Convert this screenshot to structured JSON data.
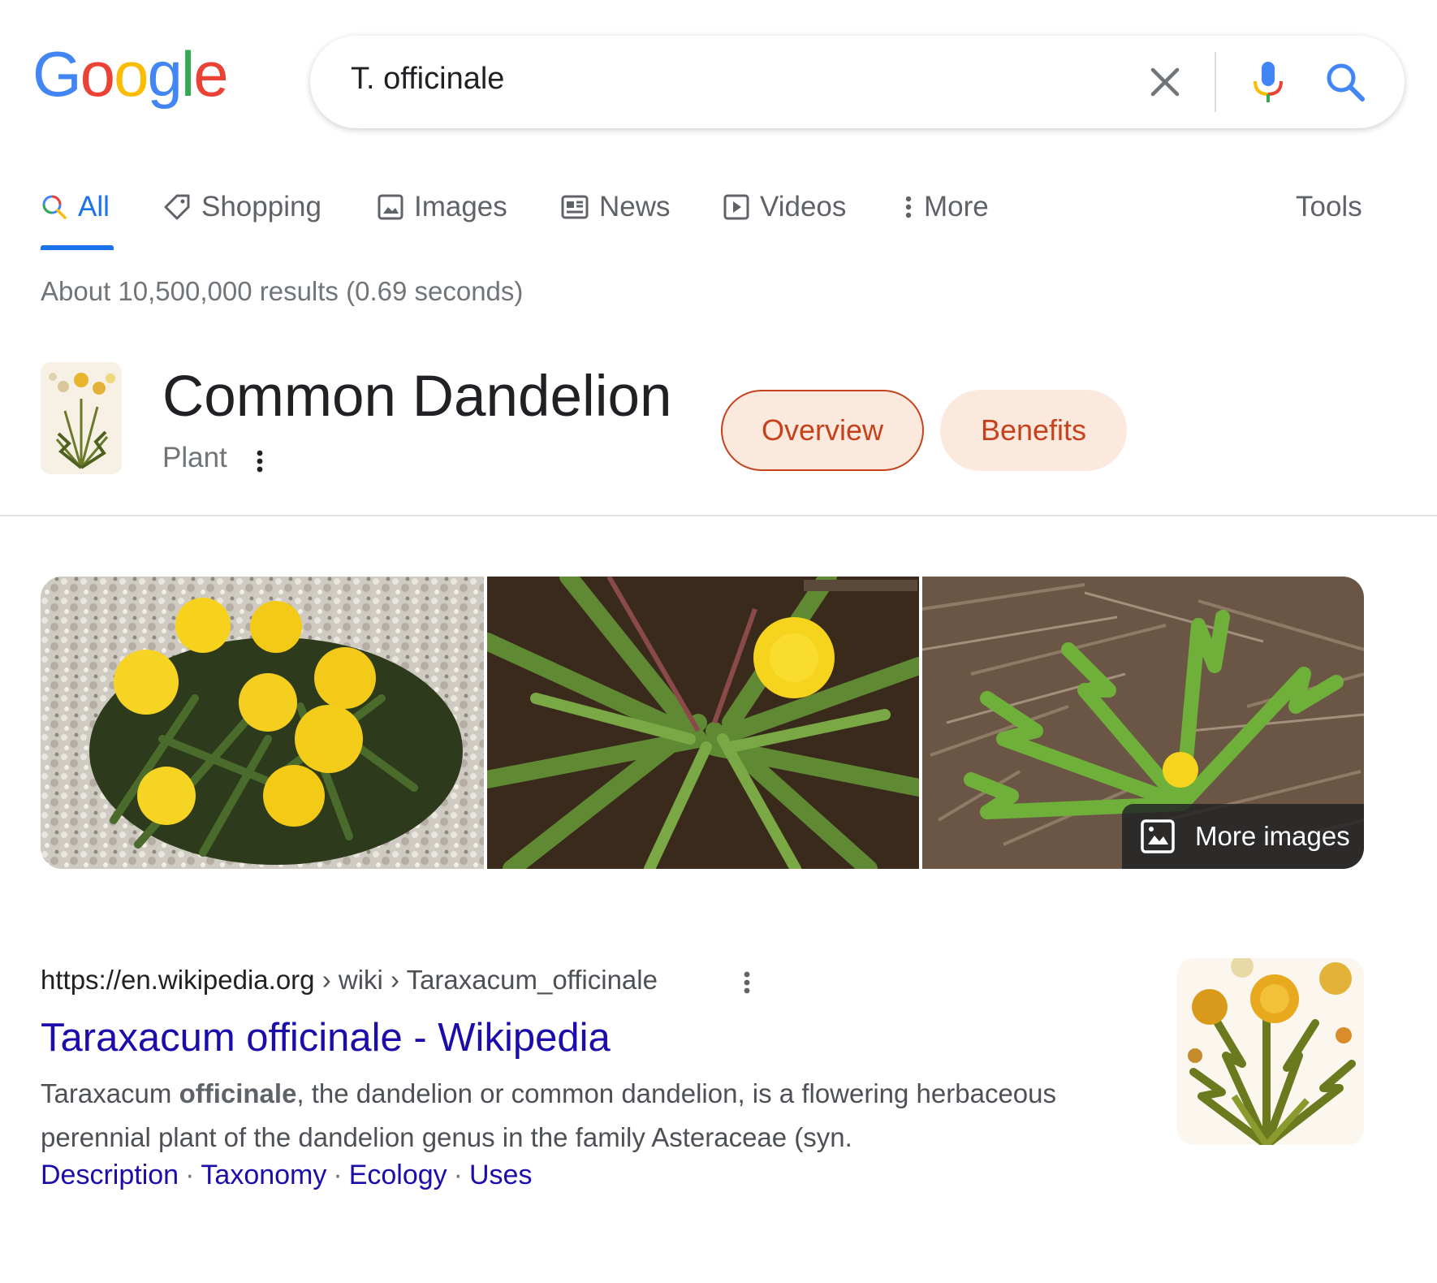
{
  "logo": {
    "letters": [
      "G",
      "o",
      "o",
      "g",
      "l",
      "e"
    ],
    "colors": [
      "#4285F4",
      "#EA4335",
      "#FBBC05",
      "#4285F4",
      "#34A853",
      "#EA4335"
    ]
  },
  "search": {
    "query": "T. officinale"
  },
  "tabs": {
    "all": "All",
    "shopping": "Shopping",
    "images": "Images",
    "news": "News",
    "videos": "Videos",
    "more": "More",
    "tools": "Tools",
    "active": "all"
  },
  "result_stats": "About 10,500,000 results (0.69 seconds)",
  "knowledge": {
    "title": "Common Dandelion",
    "subtitle": "Plant",
    "pills": [
      "Overview",
      "Benefits"
    ],
    "selected_pill": "Overview"
  },
  "images_strip": {
    "more_images": "More images"
  },
  "result": {
    "url_domain": "https://en.wikipedia.org",
    "url_path": " › wiki › Taraxacum_officinale",
    "title": "Taraxacum officinale - Wikipedia",
    "snippet_before": "Taraxacum ",
    "snippet_bold": "officinale",
    "snippet_after": ", the dandelion or common dandelion, is a flowering herbaceous perennial plant of the dandelion genus in the family Asteraceae (syn.",
    "sitelinks": [
      "Description",
      "Taxonomy",
      "Ecology",
      "Uses"
    ]
  },
  "colors": {
    "link": "#1a0dab",
    "accent": "#1a73e8",
    "pill_bg": "#fbe9dd",
    "pill_text": "#c5421d"
  }
}
